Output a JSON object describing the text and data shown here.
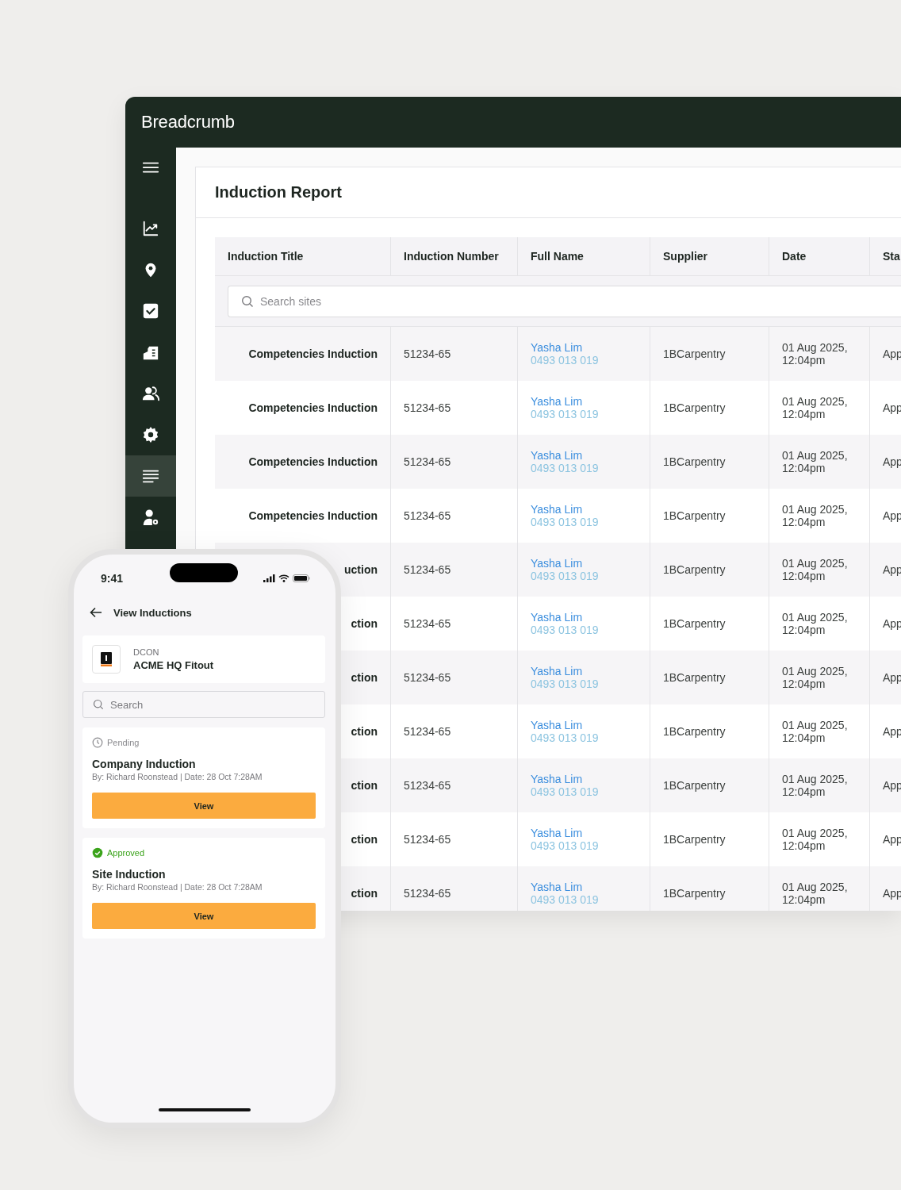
{
  "app": {
    "logo": "Breadcrumb",
    "sidebar": [
      {
        "kind": "menu",
        "selected": false
      },
      {
        "kind": "chart",
        "selected": false
      },
      {
        "kind": "pin",
        "selected": false
      },
      {
        "kind": "check",
        "selected": false
      },
      {
        "kind": "building",
        "selected": false
      },
      {
        "kind": "users",
        "selected": false
      },
      {
        "kind": "gear",
        "selected": false
      },
      {
        "kind": "list",
        "selected": true
      },
      {
        "kind": "user-gear",
        "selected": false
      }
    ],
    "report": {
      "title": "Induction Report",
      "columns": [
        "Induction Title",
        "Induction Number",
        "Full Name",
        "Supplier",
        "Date",
        "Sta"
      ],
      "search": {
        "placeholder": "Search sites"
      },
      "rows": [
        {
          "title": "Competencies Induction",
          "number": "51234-65",
          "name": "Yasha Lim",
          "phone": "0493 013 019",
          "supplier": "1BCarpentry",
          "date": "01 Aug 2025, 12:04pm",
          "status": "App"
        },
        {
          "title": "Competencies Induction",
          "number": "51234-65",
          "name": "Yasha Lim",
          "phone": "0493 013 019",
          "supplier": "1BCarpentry",
          "date": "01 Aug 2025, 12:04pm",
          "status": "App"
        },
        {
          "title": "Competencies Induction",
          "number": "51234-65",
          "name": "Yasha Lim",
          "phone": "0493 013 019",
          "supplier": "1BCarpentry",
          "date": "01 Aug 2025, 12:04pm",
          "status": "App"
        },
        {
          "title": "Competencies Induction",
          "number": "51234-65",
          "name": "Yasha Lim",
          "phone": "0493 013 019",
          "supplier": "1BCarpentry",
          "date": "01 Aug 2025, 12:04pm",
          "status": "App"
        },
        {
          "title": "uction",
          "number": "51234-65",
          "name": "Yasha Lim",
          "phone": "0493 013 019",
          "supplier": "1BCarpentry",
          "date": "01 Aug 2025, 12:04pm",
          "status": "App"
        },
        {
          "title": "ction",
          "number": "51234-65",
          "name": "Yasha Lim",
          "phone": "0493 013 019",
          "supplier": "1BCarpentry",
          "date": "01 Aug 2025, 12:04pm",
          "status": "App"
        },
        {
          "title": "ction",
          "number": "51234-65",
          "name": "Yasha Lim",
          "phone": "0493 013 019",
          "supplier": "1BCarpentry",
          "date": "01 Aug 2025, 12:04pm",
          "status": "App"
        },
        {
          "title": "ction",
          "number": "51234-65",
          "name": "Yasha Lim",
          "phone": "0493 013 019",
          "supplier": "1BCarpentry",
          "date": "01 Aug 2025, 12:04pm",
          "status": "App"
        },
        {
          "title": "ction",
          "number": "51234-65",
          "name": "Yasha Lim",
          "phone": "0493 013 019",
          "supplier": "1BCarpentry",
          "date": "01 Aug 2025, 12:04pm",
          "status": "App"
        },
        {
          "title": "ction",
          "number": "51234-65",
          "name": "Yasha Lim",
          "phone": "0493 013 019",
          "supplier": "1BCarpentry",
          "date": "01 Aug 2025, 12:04pm",
          "status": "App"
        },
        {
          "title": "ction",
          "number": "51234-65",
          "name": "Yasha Lim",
          "phone": "0493 013 019",
          "supplier": "1BCarpentry",
          "date": "01 Aug 2025, 12:04pm",
          "status": "App"
        }
      ]
    }
  },
  "phone": {
    "time": "9:41",
    "title": "View Inductions",
    "site": {
      "org": "DCON",
      "name": "ACME HQ Fitout"
    },
    "search": {
      "placeholder": "Search"
    },
    "inductions": [
      {
        "kind": "pending",
        "status": "Pending",
        "title": "Company Induction",
        "meta": "By: Richard Roonstead | Date: 28 Oct 7:28AM",
        "action": "View"
      },
      {
        "kind": "approved",
        "status": "Approved",
        "title": "Site Induction",
        "meta": "By: Richard Roonstead | Date: 28 Oct 7:28AM",
        "action": "View"
      }
    ]
  }
}
